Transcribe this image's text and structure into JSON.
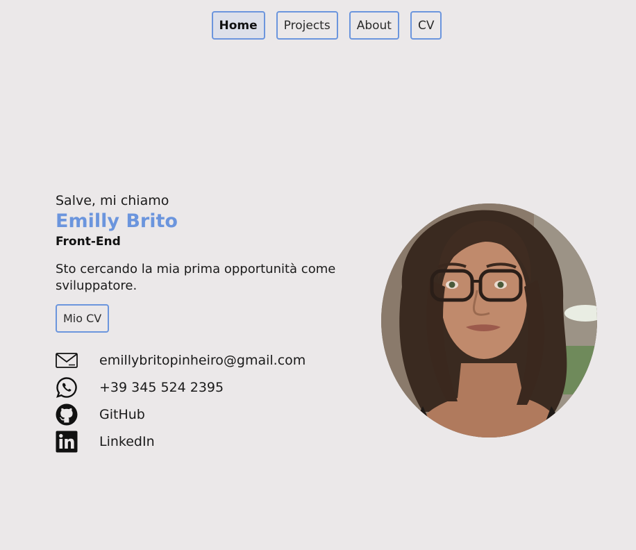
{
  "nav": {
    "items": [
      {
        "label": "Home",
        "active": true
      },
      {
        "label": "Projects",
        "active": false
      },
      {
        "label": "About",
        "active": false
      },
      {
        "label": "CV",
        "active": false
      }
    ]
  },
  "intro": {
    "greeting": "Salve, mi chiamo",
    "name": "Emilly Brito",
    "role": "Front-End",
    "tagline": "Sto cercando la mia prima opportunità come sviluppatore.",
    "cv_button": "Mio CV"
  },
  "contacts": [
    {
      "icon": "mail-icon",
      "text": "emillybritopinheiro@gmail.com"
    },
    {
      "icon": "whatsapp-icon",
      "text": "+39 345 524 2395"
    },
    {
      "icon": "github-icon",
      "text": "GitHub"
    },
    {
      "icon": "linkedin-icon",
      "text": "LinkedIn"
    }
  ],
  "colors": {
    "background": "#ebe8e9",
    "accent": "#6b95dd",
    "text": "#1a1a1a"
  }
}
